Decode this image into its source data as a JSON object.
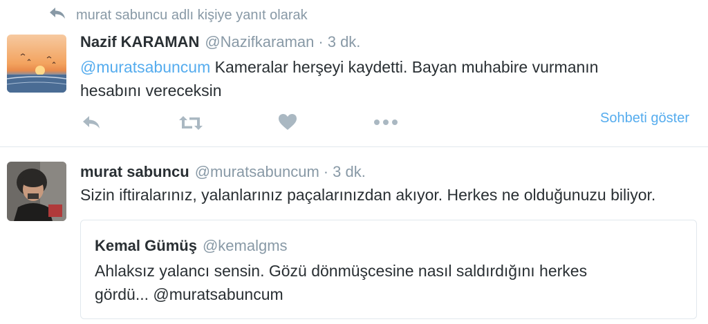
{
  "context": {
    "reply_to_text": "murat sabuncu adlı kişiye yanıt olarak",
    "icon": "reply-icon"
  },
  "tweet1": {
    "name": "Nazif KARAMAN",
    "handle": "@Nazifkaraman",
    "separator": "·",
    "time": "3 dk.",
    "mention": "@muratsabuncum",
    "text_line1_rest": " Kameralar herşeyi kaydetti. Bayan muhabire vurmanın",
    "text_line2": "hesabını vereceksin",
    "show_conversation": "Sohbeti göster",
    "actions": [
      "reply-icon",
      "retweet-icon",
      "like-icon",
      "more-icon"
    ]
  },
  "tweet2": {
    "name": "murat sabuncu",
    "handle": "@muratsabuncum",
    "separator": "·",
    "time": "3 dk.",
    "text": "Sizin iftiralarınız, yalanlarınız paçalarınızdan akıyor. Herkes ne olduğunuzu biliyor."
  },
  "quote": {
    "name": "Kemal Gümüş",
    "handle": "@kemalgms",
    "text_line1": "Ahlaksız yalancı sensin. Gözü dönmüşcesine nasıl saldırdığını herkes",
    "text_line2": "gördü... @muratsabuncum"
  },
  "colors": {
    "accent": "#55acee",
    "muted": "#8899a6",
    "text": "#292f33",
    "border": "#e1e8ed"
  }
}
